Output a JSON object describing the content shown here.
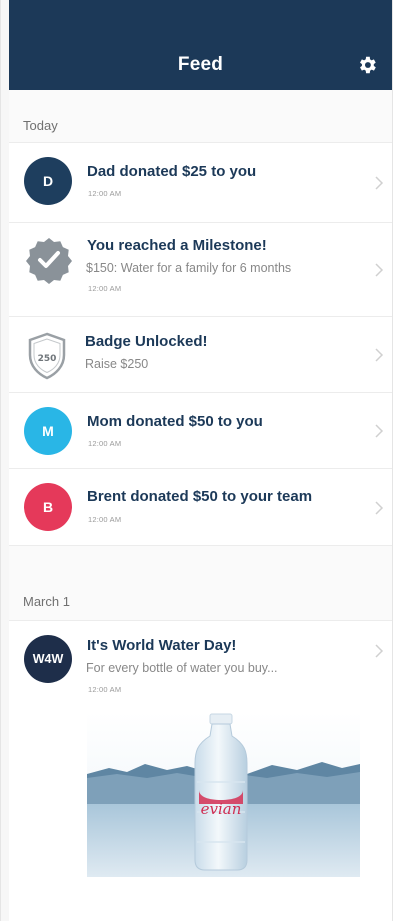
{
  "header": {
    "title": "Feed",
    "settings_icon": "gear-icon"
  },
  "sections": [
    {
      "label": "Today"
    },
    {
      "label": "March 1"
    }
  ],
  "today": [
    {
      "avatar": "D",
      "avatar_color": "#1e3e5e",
      "title": "Dad donated $25 to you",
      "time": "12:00 AM"
    },
    {
      "icon": "milestone-badge-icon",
      "icon_color": "#8a9299",
      "title": "You reached a Milestone!",
      "subtitle": "$150: Water for a family for 6 months",
      "time": "12:00 AM"
    },
    {
      "icon": "shield-badge-icon",
      "badge_number": "250",
      "title": "Badge Unlocked!",
      "subtitle": "Raise $250"
    },
    {
      "avatar": "M",
      "avatar_color": "#29b6e6",
      "title": "Mom donated $50 to you",
      "time": "12:00 AM"
    },
    {
      "avatar": "B",
      "avatar_color": "#e5395a",
      "title": "Brent donated $50 to your team",
      "time": "12:00 AM"
    }
  ],
  "march1": [
    {
      "avatar": "W4W",
      "avatar_color": "#1e2e4a",
      "title": "It's World Water Day!",
      "subtitle": "For every bottle of water you buy...",
      "time": "12:00 AM",
      "image": {
        "brand": "evian",
        "description_icon": "water-bottle-image"
      }
    }
  ]
}
